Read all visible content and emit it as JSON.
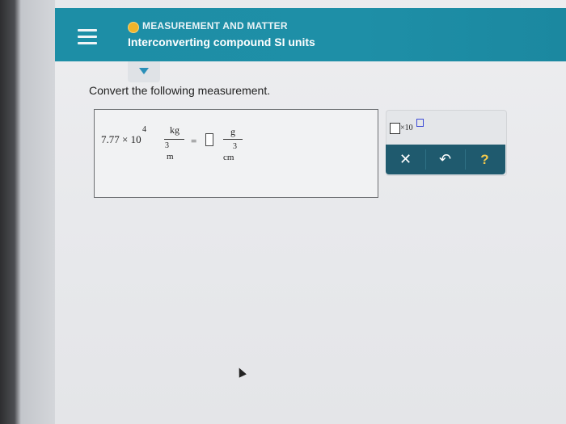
{
  "header": {
    "topic": "MEASUREMENT AND MATTER",
    "title": "Interconverting compound SI units"
  },
  "main": {
    "instruction": "Convert the following measurement."
  },
  "expression": {
    "coefficient": "7.77 × 10",
    "exponent": "4",
    "unit_numerator": "kg",
    "unit_denominator": "m",
    "unit_denominator_exp": "3",
    "equals": "=",
    "target_numerator": "g",
    "target_denominator": "cm",
    "target_denominator_exp": "3"
  },
  "tools": {
    "sci_notation_label": "×10",
    "clear_label": "✕",
    "undo_label": "↶",
    "help_label": "?"
  },
  "colors": {
    "header_bg": "#1d8ea6",
    "topic_dot": "#f0b429",
    "action_bar": "#1f5a6e",
    "help_icon": "#f2c94c"
  }
}
